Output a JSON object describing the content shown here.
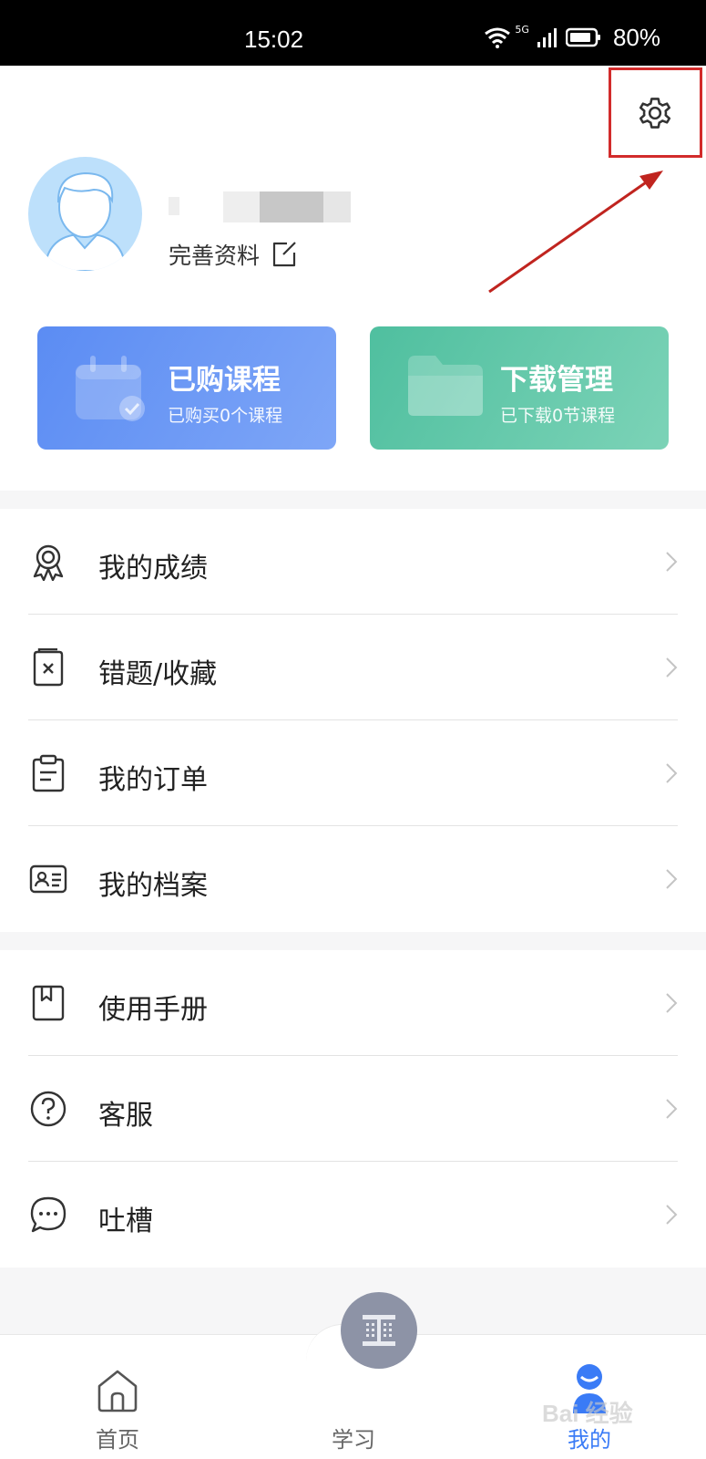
{
  "status_bar": {
    "time": "15:02",
    "network": "5G",
    "battery": "80%"
  },
  "header": {
    "settings_icon": "gear-icon"
  },
  "profile": {
    "avatar_icon": "user-avatar",
    "complete_profile": "完善资料",
    "edit_icon": "edit-icon"
  },
  "cards": [
    {
      "title": "已购课程",
      "subtitle": "已购买0个课程",
      "icon": "calendar-check-icon"
    },
    {
      "title": "下载管理",
      "subtitle": "已下载0节课程",
      "icon": "folder-icon"
    }
  ],
  "menu_group_1": [
    {
      "label": "我的成绩",
      "icon": "award-icon"
    },
    {
      "label": "错题/收藏",
      "icon": "wrong-question-icon"
    },
    {
      "label": "我的订单",
      "icon": "clipboard-icon"
    },
    {
      "label": "我的档案",
      "icon": "id-card-icon"
    }
  ],
  "menu_group_2": [
    {
      "label": "使用手册",
      "icon": "bookmark-book-icon"
    },
    {
      "label": "客服",
      "icon": "help-circle-icon"
    },
    {
      "label": "吐槽",
      "icon": "chat-bubble-icon"
    }
  ],
  "tab_bar": {
    "items": [
      {
        "label": "首页",
        "icon": "home-icon",
        "active": false
      },
      {
        "label": "学习",
        "icon": "study-icon",
        "active": false
      },
      {
        "label": "我的",
        "icon": "profile-icon",
        "active": true
      }
    ]
  },
  "colors": {
    "accent": "#3a7bf6",
    "card_blue": "#5b8cf3",
    "card_green": "#4fbf9f",
    "highlight": "#d22b2b"
  },
  "watermark": "Bai 经验"
}
